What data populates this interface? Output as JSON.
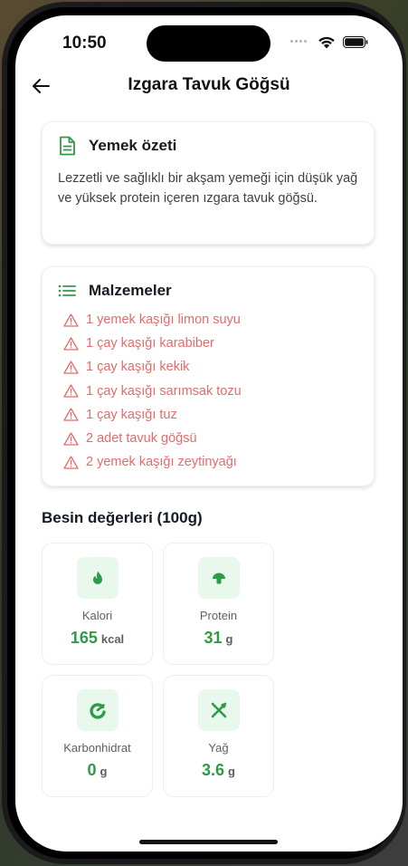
{
  "status_bar": {
    "time": "10:50"
  },
  "header": {
    "title": "Izgara Tavuk Göğsü",
    "back_icon": "arrow-left-icon"
  },
  "summary": {
    "title": "Yemek özeti",
    "icon": "document-icon",
    "text": "Lezzetli ve sağlıklı bir akşam yemeği için düşük yağ ve yüksek protein içeren ızgara tavuk göğsü."
  },
  "ingredients": {
    "title": "Malzemeler",
    "icon": "list-icon",
    "item_icon": "warning-triangle-icon",
    "items": [
      "1 yemek kaşığı limon suyu",
      "1 çay kaşığı karabiber",
      "1 çay kaşığı kekik",
      "1 çay kaşığı sarımsak tozu",
      "1 çay kaşığı tuz",
      "2 adet tavuk göğsü",
      "2 yemek kaşığı zeytinyağı"
    ]
  },
  "nutrition": {
    "title": "Besin değerleri (100g)",
    "items": [
      {
        "label": "Kalori",
        "value": "165",
        "unit": "kcal",
        "icon": "calorie-icon"
      },
      {
        "label": "Protein",
        "value": "31",
        "unit": "g",
        "icon": "protein-icon"
      },
      {
        "label": "Karbonhidrat",
        "value": "0",
        "unit": "g",
        "icon": "carb-icon"
      },
      {
        "label": "Yağ",
        "value": "3.6",
        "unit": "g",
        "icon": "fat-icon"
      }
    ]
  },
  "colors": {
    "accent_green": "#2f9a48",
    "icon_bg": "#e9f8ec",
    "ingredient_red": "#e66a6a"
  }
}
